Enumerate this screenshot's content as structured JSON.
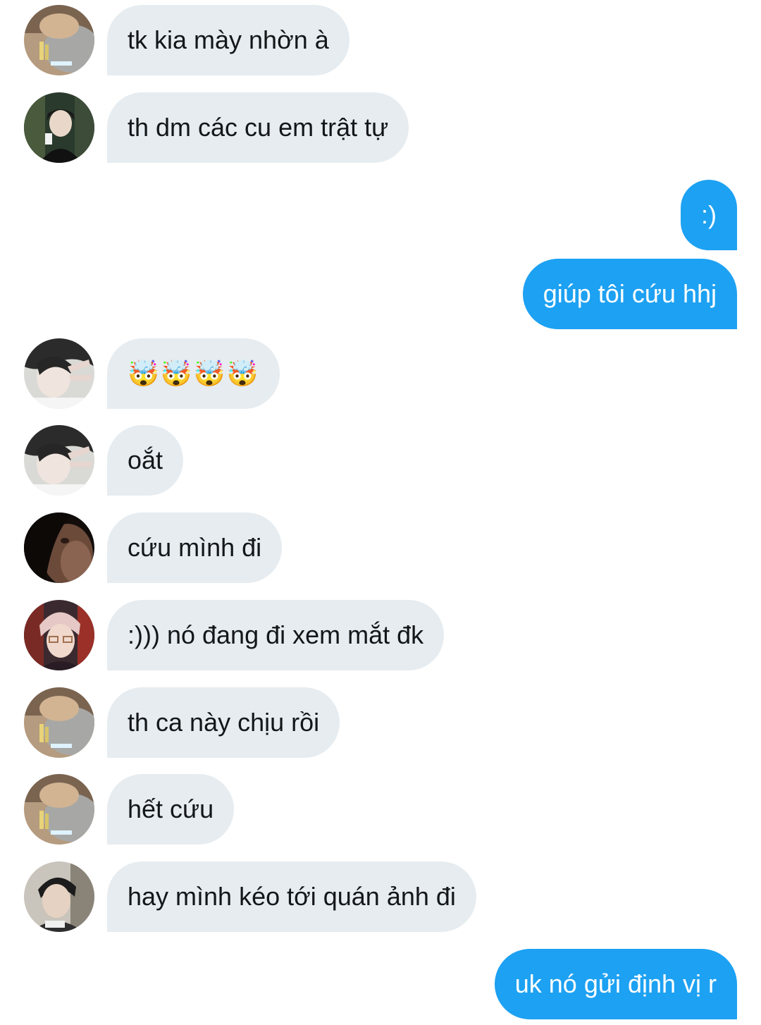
{
  "conversation": {
    "messages": [
      {
        "direction": "in",
        "text": "tk kia mày nhờn à",
        "avatar": "avatar-1"
      },
      {
        "direction": "in",
        "text": "th dm các cu em trật tự",
        "avatar": "avatar-2"
      },
      {
        "direction": "out",
        "text": ":)"
      },
      {
        "direction": "out",
        "text": "giúp tôi cứu hhj"
      },
      {
        "direction": "in",
        "text": "🤯🤯🤯🤯",
        "avatar": "avatar-3"
      },
      {
        "direction": "in",
        "text": "oắt",
        "avatar": "avatar-3"
      },
      {
        "direction": "in",
        "text": "cứu mình đi",
        "avatar": "avatar-4"
      },
      {
        "direction": "in",
        "text": ":))) nó đang đi xem mắt đk",
        "avatar": "avatar-5"
      },
      {
        "direction": "in",
        "text": "th ca này chịu rồi",
        "avatar": "avatar-1"
      },
      {
        "direction": "in",
        "text": "hết cứu",
        "avatar": "avatar-1"
      },
      {
        "direction": "in",
        "text": "hay mình kéo tới quán ảnh đi",
        "avatar": "avatar-6"
      },
      {
        "direction": "out",
        "text": "uk nó gửi định vị r"
      }
    ]
  },
  "colors": {
    "incoming_bubble": "#e6ecf0",
    "outgoing_bubble": "#1da1f2",
    "incoming_text": "#14171a",
    "outgoing_text": "#ffffff"
  }
}
